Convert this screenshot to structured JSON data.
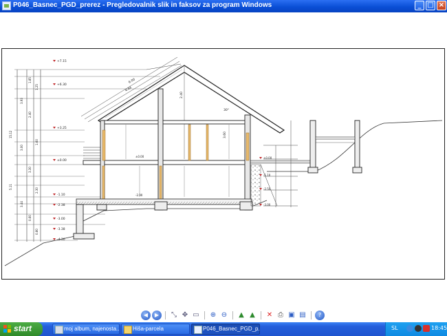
{
  "window": {
    "title": "P046_Basnec_PGD_prerez - Pregledovalnik slik in faksov za program Windows",
    "buttons": [
      "minimize",
      "maximize",
      "close"
    ]
  },
  "drawing": {
    "left_elevations": [
      "+7.15",
      "+6.30",
      "+3.25",
      "±0.00",
      "-1.10",
      "-2.38",
      "-3.00",
      "-3.38",
      "-4.30"
    ],
    "right_elevations": [
      "±0.00",
      "-1.10",
      "-2.50",
      "-3.00"
    ],
    "floor_labels": [
      "±0.00",
      "-2.90"
    ],
    "dimension_labels": [
      "6.00",
      "4.44",
      "30°",
      "2.40",
      "3.60"
    ]
  },
  "toolbar": {
    "icons": [
      "previous-image-icon",
      "next-image-icon",
      "best-fit-icon",
      "actual-size-icon",
      "slideshow-icon",
      "zoom-in-icon",
      "zoom-out-icon",
      "rotate-clockwise-icon",
      "rotate-counterclockwise-icon",
      "delete-icon",
      "print-icon",
      "save-icon",
      "edit-icon",
      "help-icon"
    ]
  },
  "taskbar": {
    "start_label": "start",
    "tasks": [
      {
        "label": "moj album, najenosta...",
        "icon": "browser-icon",
        "active": false
      },
      {
        "label": "Hiša-parcela",
        "icon": "folder-icon",
        "active": false
      },
      {
        "label": "P046_Basnec_PGD_p...",
        "icon": "image-viewer-icon",
        "active": true
      }
    ],
    "tray": {
      "language": "SL",
      "clock": "18:45"
    }
  },
  "colors": {
    "titlebar": "#0a4fd6",
    "taskbar": "#245edb",
    "start": "#2f8a2a",
    "dimension_red": "#c0282a",
    "timber": "#e8b96a"
  }
}
